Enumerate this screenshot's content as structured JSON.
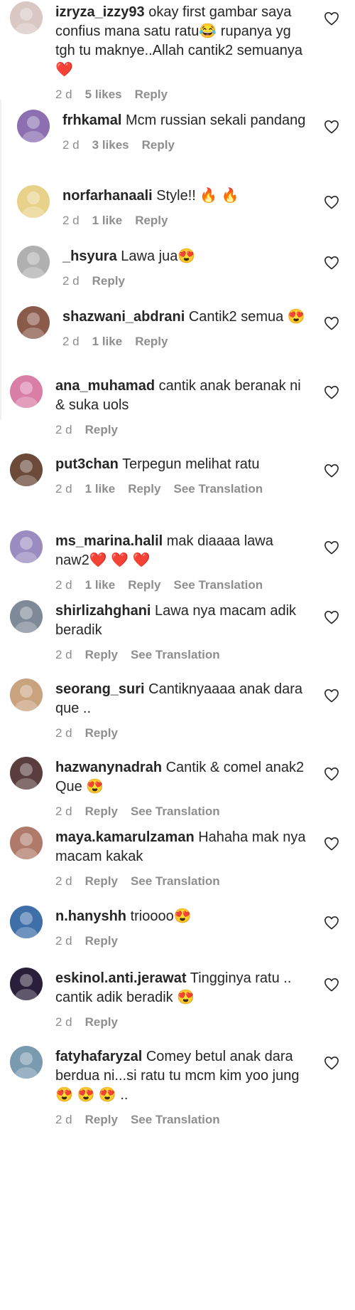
{
  "comments": [
    {
      "username": "izryza_izzy93",
      "text": "okay first gambar saya confius mana satu ratu😂 rupanya yg tgh tu maknye..Allah cantik2 semuanya ❤️",
      "time": "2 d",
      "likes": "5 likes",
      "reply": "Reply",
      "translate": "",
      "avatar_color": "#d9c7c3"
    },
    {
      "username": "frhkamal",
      "text": "Mcm russian sekali pandang",
      "time": "2 d",
      "likes": "3 likes",
      "reply": "Reply",
      "translate": "",
      "avatar_color": "#8c6fb0"
    },
    {
      "username": "norfarhanaali",
      "text": "Style!! 🔥 🔥",
      "time": "2 d",
      "likes": "1 like",
      "reply": "Reply",
      "translate": "",
      "avatar_color": "#e8d28a"
    },
    {
      "username": "_hsyura",
      "text": "Lawa jua😍",
      "time": "2 d",
      "likes": "",
      "reply": "Reply",
      "translate": "",
      "avatar_color": "#b0b0b0"
    },
    {
      "username": "shazwani_abdrani",
      "text": "Cantik2 semua 😍",
      "time": "2 d",
      "likes": "1 like",
      "reply": "Reply",
      "translate": "",
      "avatar_color": "#8a5a4a"
    },
    {
      "username": "ana_muhamad",
      "text": "cantik anak beranak ni & suka uols",
      "time": "2 d",
      "likes": "",
      "reply": "Reply",
      "translate": "",
      "avatar_color": "#d97fa6"
    },
    {
      "username": "put3chan",
      "text": "Terpegun melihat ratu",
      "time": "2 d",
      "likes": "1 like",
      "reply": "Reply",
      "translate": "See Translation",
      "avatar_color": "#6b4a3a"
    },
    {
      "username": "ms_marina.halil",
      "text": "mak diaaaa lawa naw2❤️ ❤️ ❤️",
      "time": "2 d",
      "likes": "1 like",
      "reply": "Reply",
      "translate": "See Translation",
      "avatar_color": "#9a8cc0"
    },
    {
      "username": "shirlizahghani",
      "text": "Lawa nya macam adik beradik",
      "time": "2 d",
      "likes": "",
      "reply": "Reply",
      "translate": "See Translation",
      "avatar_color": "#7f8a98"
    },
    {
      "username": "seorang_suri",
      "text": "Cantiknyaaaa anak dara que ..",
      "time": "2 d",
      "likes": "",
      "reply": "Reply",
      "translate": "",
      "avatar_color": "#c9a27e"
    },
    {
      "username": "hazwanynadrah",
      "text": "Cantik & comel anak2 Que 😍",
      "time": "2 d",
      "likes": "",
      "reply": "Reply",
      "translate": "See Translation",
      "avatar_color": "#5a3d3d"
    },
    {
      "username": "maya.kamarulzaman",
      "text": "Hahaha mak nya macam kakak",
      "time": "2 d",
      "likes": "",
      "reply": "Reply",
      "translate": "See Translation",
      "avatar_color": "#b07a6a"
    },
    {
      "username": "n.hanyshh",
      "text": "trioooo😍",
      "time": "2 d",
      "likes": "",
      "reply": "Reply",
      "translate": "",
      "avatar_color": "#3e6fa8"
    },
    {
      "username": "eskinol.anti.jerawat",
      "text": "Tingginya ratu .. cantik adik beradik 😍",
      "time": "2 d",
      "likes": "",
      "reply": "Reply",
      "translate": "",
      "avatar_color": "#2a1f3a"
    },
    {
      "username": "fatyhafaryzal",
      "text": "Comey betul anak dara berdua ni...si ratu tu mcm kim yoo jung😍 😍 😍 ..",
      "time": "2 d",
      "likes": "",
      "reply": "Reply",
      "translate": "See Translation",
      "avatar_color": "#7a9ab0"
    }
  ]
}
